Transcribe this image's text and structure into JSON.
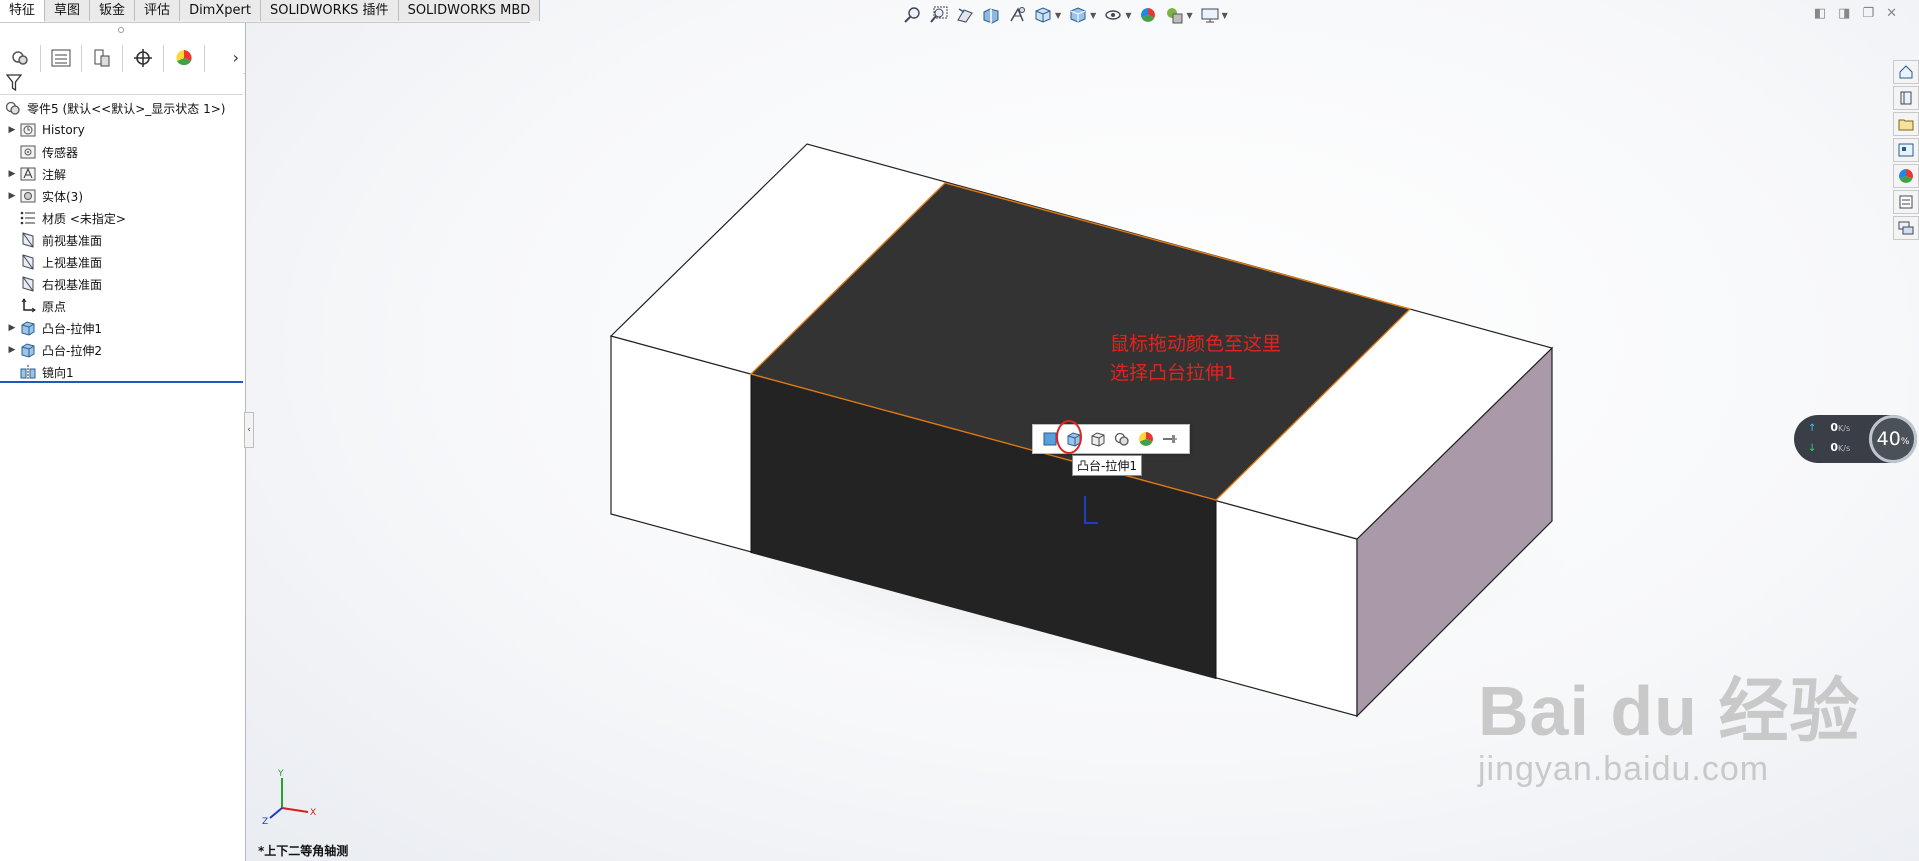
{
  "command_tabs": [
    "特征",
    "草图",
    "钣金",
    "评估",
    "DimXpert",
    "SOLIDWORKS 插件",
    "SOLIDWORKS MBD"
  ],
  "active_tab_index": 0,
  "tree": {
    "root_label": "零件5  (默认<<默认>_显示状态 1>)",
    "items": [
      {
        "label": "History",
        "expandable": true,
        "icon": "history-icon"
      },
      {
        "label": "传感器",
        "expandable": false,
        "icon": "sensor-icon"
      },
      {
        "label": "注解",
        "expandable": true,
        "icon": "annotation-icon"
      },
      {
        "label": "实体(3)",
        "expandable": true,
        "icon": "solid-bodies-icon"
      },
      {
        "label": "材质 <未指定>",
        "expandable": false,
        "icon": "material-icon"
      },
      {
        "label": "前视基准面",
        "expandable": false,
        "icon": "plane-icon"
      },
      {
        "label": "上视基准面",
        "expandable": false,
        "icon": "plane-icon"
      },
      {
        "label": "右视基准面",
        "expandable": false,
        "icon": "plane-icon"
      },
      {
        "label": "原点",
        "expandable": false,
        "icon": "origin-icon"
      },
      {
        "label": "凸台-拉伸1",
        "expandable": true,
        "icon": "extrude-icon"
      },
      {
        "label": "凸台-拉伸2",
        "expandable": true,
        "icon": "extrude-icon"
      },
      {
        "label": "镜向1",
        "expandable": false,
        "icon": "mirror-icon"
      }
    ]
  },
  "annotation": {
    "line1": "鼠标拖动颜色至这里",
    "line2": "选择凸台拉伸1"
  },
  "tooltip": "凸台-拉伸1",
  "speed_widget": {
    "upload": "0",
    "download": "0",
    "unit": "K/s",
    "percent": "40",
    "percent_sign": "%"
  },
  "view_name": "*上下二等角轴测",
  "watermark": {
    "brand": "Bai du 经验",
    "site": "jingyan.baidu.com"
  },
  "colors": {
    "annotation_red": "#e3231e",
    "top_face_dark": "#333333",
    "front_face_dark": "#232323",
    "side_face": "#a999a9",
    "edge_highlight": "#e07a12",
    "selection_blue": "#1f57c3"
  }
}
